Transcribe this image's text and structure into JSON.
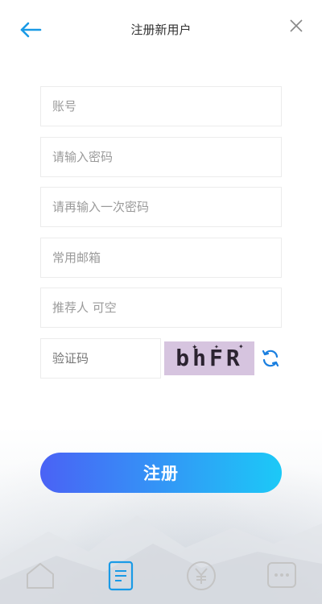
{
  "header": {
    "title": "注册新用户",
    "back_icon": "arrow-left-icon",
    "close_icon": "close-icon"
  },
  "form": {
    "account_placeholder": "账号",
    "password_placeholder": "请输入密码",
    "confirm_password_placeholder": "请再输入一次密码",
    "email_placeholder": "常用邮箱",
    "referrer_placeholder": "推荐人 可空",
    "captcha_placeholder": "验证码",
    "captcha_text": "bhFR",
    "refresh_icon": "refresh-icon"
  },
  "submit": {
    "label": "注册"
  },
  "tabbar": {
    "items": [
      {
        "icon": "home-icon",
        "active": false
      },
      {
        "icon": "document-icon",
        "active": true
      },
      {
        "icon": "yen-icon",
        "active": false
      },
      {
        "icon": "chat-icon",
        "active": false
      }
    ]
  },
  "colors": {
    "accent": "#1a9ae6",
    "button_gradient_start": "#4a62f5",
    "button_gradient_end": "#1cc9f7",
    "captcha_bg": "#d6c4df",
    "inactive_icon": "#c8c8c8"
  }
}
